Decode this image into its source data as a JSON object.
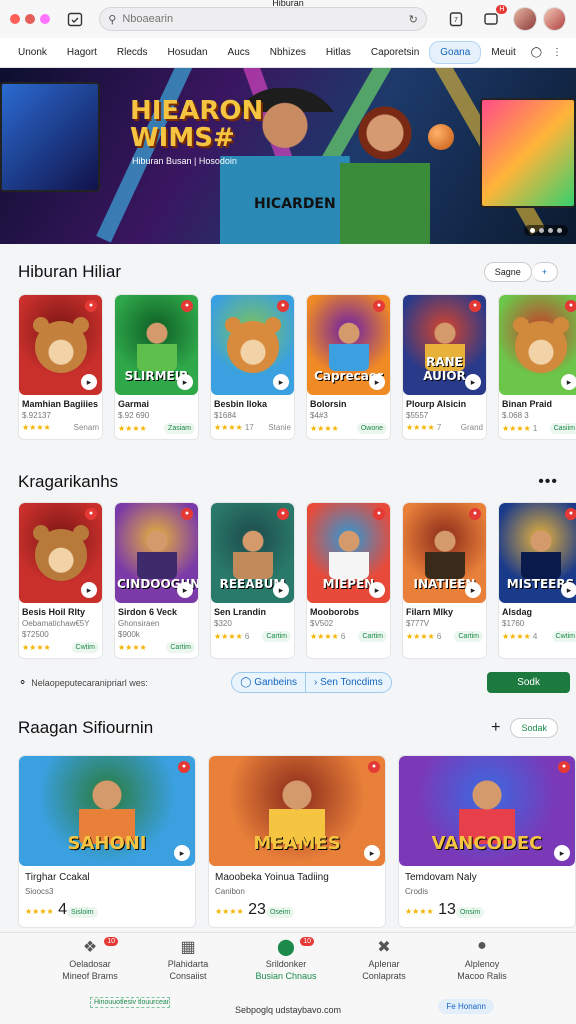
{
  "window": {
    "title": "Hiburan"
  },
  "search": {
    "placeholder": "Nboaearin",
    "value": ""
  },
  "icons": {
    "calendar": "calendar-icon",
    "refresh": "refresh-icon",
    "notification_count": "H"
  },
  "tabs": [
    "Unonk",
    "Hagort",
    "Rlecds",
    "Hosudan",
    "Aucs",
    "Nbhizes",
    "Hitlas",
    "Caporetsin",
    "Goana",
    "Meuit"
  ],
  "hero": {
    "title_line1": "HIEARON",
    "title_line2": "WIMS#",
    "subtitle": "Hiburan Busan | Hosodoin",
    "shirt": "HICARDEN"
  },
  "section1": {
    "title": "Hiburan Hiliar",
    "pill_label": "Sagne",
    "cards": [
      {
        "name": "Mamhian Bagiiies",
        "meta": "$.92137",
        "right": "Senam",
        "badge": "8"
      },
      {
        "name": "Garmai",
        "meta": "$.92 690",
        "right": "Zasiam",
        "thumb_title": "SLIRMEIR"
      },
      {
        "name": "Besbin lloka",
        "meta": "$1684",
        "stars_text": "17",
        "right": "Stanie"
      },
      {
        "name": "Bolorsin",
        "meta": "$4#3",
        "right": "Owone",
        "thumb_title": "Caprecaer"
      },
      {
        "name": "Plourp Alsicin",
        "meta": "$5557",
        "stars_text": "7",
        "right": "Grand",
        "thumb_title": "RANE AUIOR"
      },
      {
        "name": "Binan Praid",
        "meta": "$.068 3",
        "stars_text": "1",
        "right": "Casiim",
        "badge": "8"
      }
    ]
  },
  "section2": {
    "title": "Kragarikanhs",
    "cards": [
      {
        "name": "Besis Hoil Rlty",
        "meta": "Oebamatichaw€5Y",
        "meta2": "$72500",
        "right": "Cwtim"
      },
      {
        "name": "Sirdon 6 Veck",
        "meta": "Ghonsiraen",
        "meta2": "$900k",
        "right": "Cartim",
        "thumb_title": "CINDOOGUN"
      },
      {
        "name": "Sen Lrandin",
        "meta": "$320",
        "stars_text": "6",
        "right": "Cartim",
        "thumb_title": "REEABUM"
      },
      {
        "name": "Mooborobs",
        "meta": "$V502",
        "stars_text": "6",
        "right": "Cartim",
        "thumb_title": "MIEPEN"
      },
      {
        "name": "Filarn Mlky",
        "meta": "$777V",
        "stars_text": "6",
        "right": "Cartim",
        "thumb_title": "INATIEEN"
      },
      {
        "name": "Alsdag",
        "meta": "$1760",
        "stars_text": "4",
        "right": "Cwtim",
        "thumb_title": "MISTEERS"
      }
    ]
  },
  "tagline": {
    "text": "Nelaopeputecaranipriarl wes:",
    "seg1": "Ganbeins",
    "seg2": "Sen Toncdims",
    "green_button": "Sodk"
  },
  "section3": {
    "title": "Raagan Sifiournin",
    "pill_label": "Sodak",
    "cards": [
      {
        "name": "Tirghar Ccakal",
        "meta": "Sioocs3",
        "stars_text": "4",
        "right": "Sisloim",
        "thumb_title": "SAHONI"
      },
      {
        "name": "Maoobeka Yoinua Tadiing",
        "meta": "Canibon",
        "stars_text": "23",
        "right": "Oseim",
        "thumb_title": "MEAMES"
      },
      {
        "name": "Temdovam Naly",
        "meta": "Crodis",
        "stars_text": "13",
        "right": "Onsim",
        "thumb_title": "VANCODEC"
      }
    ]
  },
  "bottom_nav": [
    {
      "l1": "Oeladosar",
      "l2": "Mineof Brams",
      "badge": "10"
    },
    {
      "l1": "Plahidarta",
      "l2": "Consaiist"
    },
    {
      "l1": "Srildonker",
      "l2": "Busian Chnaus",
      "badge": "10"
    },
    {
      "l1": "Aplenar",
      "l2": "Conlaprats"
    },
    {
      "l1": "Alplenoy",
      "l2": "Macoo Ralis"
    }
  ],
  "footer": {
    "note": "Sebpoglq udstaybavo.com",
    "left": "Hinouuotlesiv tlouurceaneid...",
    "btn": "Fe Honann"
  }
}
